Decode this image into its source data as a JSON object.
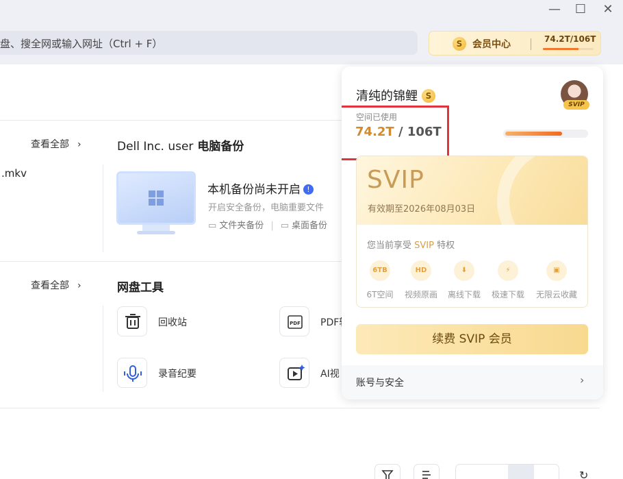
{
  "window": {
    "minimize_icon": "—",
    "maximize_icon": "☐",
    "close_icon": "✕"
  },
  "search": {
    "text": "盘、搜全网或输入网址（Ctrl + F）"
  },
  "vip_pill": {
    "coin": "S",
    "label": "会员中心",
    "capacity": "74.2T/106T",
    "used_fraction": 0.7
  },
  "recent": {
    "see_all": "查看全部",
    "file_name": ".mkv"
  },
  "backup": {
    "title_device": "Dell Inc. user",
    "title_suffix": "电脑备份",
    "status": "本机备份尚未开启",
    "desc": "开启安全备份，电脑重要文件",
    "link_folder": "文件夹备份",
    "link_desktop": "桌面备份"
  },
  "tools": {
    "see_all": "查看全部",
    "title": "网盘工具",
    "items": [
      {
        "label": "回收站",
        "icon": "trash-icon"
      },
      {
        "label": "PDF转",
        "icon": "pdf-icon"
      },
      {
        "label": "录音纪要",
        "icon": "microphone-icon"
      },
      {
        "label": "AI视",
        "icon": "ai-video-icon"
      }
    ]
  },
  "card": {
    "username": "清纯的锦鲤",
    "coin": "S",
    "avatar_badge": "SVIP",
    "space_label": "空间已使用",
    "space_used": "74.2T",
    "space_sep": " / ",
    "space_total": "106T",
    "space_fraction": 0.7,
    "svip_title": "SVIP",
    "svip_expiry": "有效期至2026年08月03日",
    "privilege_prefix": "您当前享受 ",
    "privilege_tier": "SVIP",
    "privilege_suffix": " 特权",
    "perks": [
      {
        "badge": "6TB",
        "label": "6T空间"
      },
      {
        "badge": "HD",
        "label": "视频原画"
      },
      {
        "badge": "⬇",
        "label": "离线下载"
      },
      {
        "badge": "⚡",
        "label": "极速下载"
      },
      {
        "badge": "▣",
        "label": "无限云收藏"
      }
    ],
    "renew_label": "续费 SVIP 会员",
    "account_label": "账号与安全",
    "account_chevron": "›"
  },
  "colors": {
    "accent_gold": "#d18b2e",
    "highlight_red": "#e0333b"
  }
}
